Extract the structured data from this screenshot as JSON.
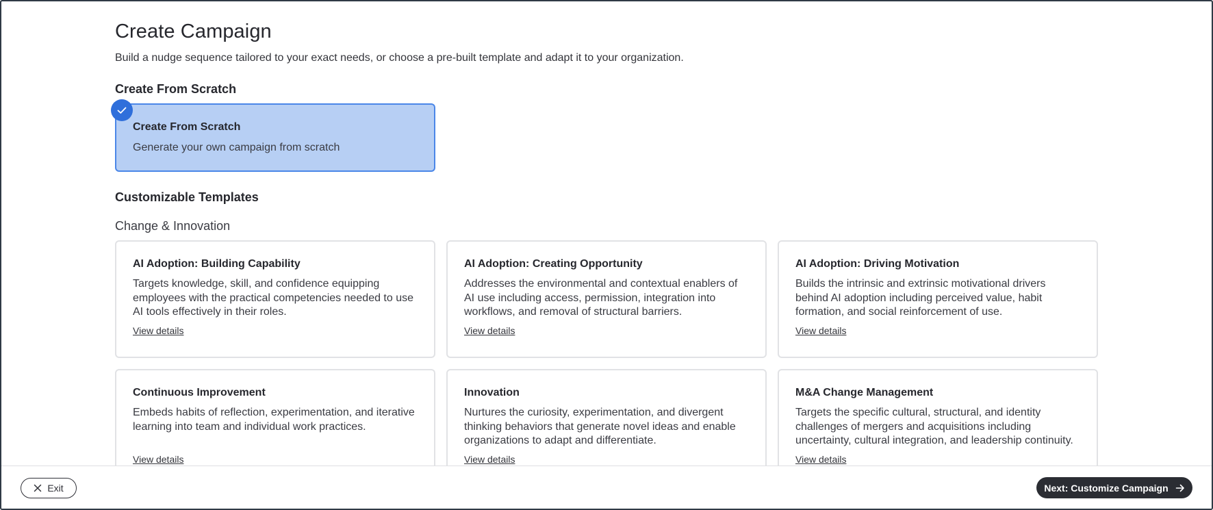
{
  "page": {
    "title": "Create Campaign",
    "subtitle": "Build a nudge sequence tailored to your exact needs, or choose a pre-built template and adapt it to your organization."
  },
  "scratch": {
    "section_title": "Create From Scratch",
    "card_title": "Create From Scratch",
    "card_description": "Generate your own campaign from scratch",
    "selected": true
  },
  "templates": {
    "section_title": "Customizable Templates",
    "category": "Change & Innovation",
    "items": [
      {
        "title": "AI Adoption: Building Capability",
        "description": "Targets knowledge, skill, and confidence equipping employees with the practical competencies needed to use AI tools effectively in their roles.",
        "link": "View details"
      },
      {
        "title": "AI Adoption: Creating Opportunity",
        "description": "Addresses the environmental and contextual enablers of AI use including access, permission, integration into workflows, and removal of structural barriers.",
        "link": "View details"
      },
      {
        "title": "AI Adoption: Driving Motivation",
        "description": "Builds the intrinsic and extrinsic motivational drivers behind AI adoption including perceived value, habit formation, and social reinforcement of use.",
        "link": "View details"
      },
      {
        "title": "Continuous Improvement",
        "description": "Embeds habits of reflection, experimentation, and iterative learning into team and individual work practices.",
        "link": "View details"
      },
      {
        "title": "Innovation",
        "description": "Nurtures the curiosity, experimentation, and divergent thinking behaviors that generate novel ideas and enable organizations to adapt and differentiate.",
        "link": "View details"
      },
      {
        "title": "M&A Change Management",
        "description": "Targets the specific cultural, structural, and identity challenges of mergers and acquisitions including uncertainty, cultural integration, and leadership continuity.",
        "link": "View details"
      }
    ]
  },
  "footer": {
    "exit_label": "Exit",
    "next_label": "Next: Customize Campaign"
  },
  "colors": {
    "selected_card_bg": "#b7cff4",
    "selected_card_border": "#4a86e8",
    "check_badge": "#2f6fdb",
    "primary_button": "#2b2d33"
  },
  "icons": {
    "check": "check-icon",
    "exit": "close-icon",
    "next": "arrow-right-icon"
  }
}
